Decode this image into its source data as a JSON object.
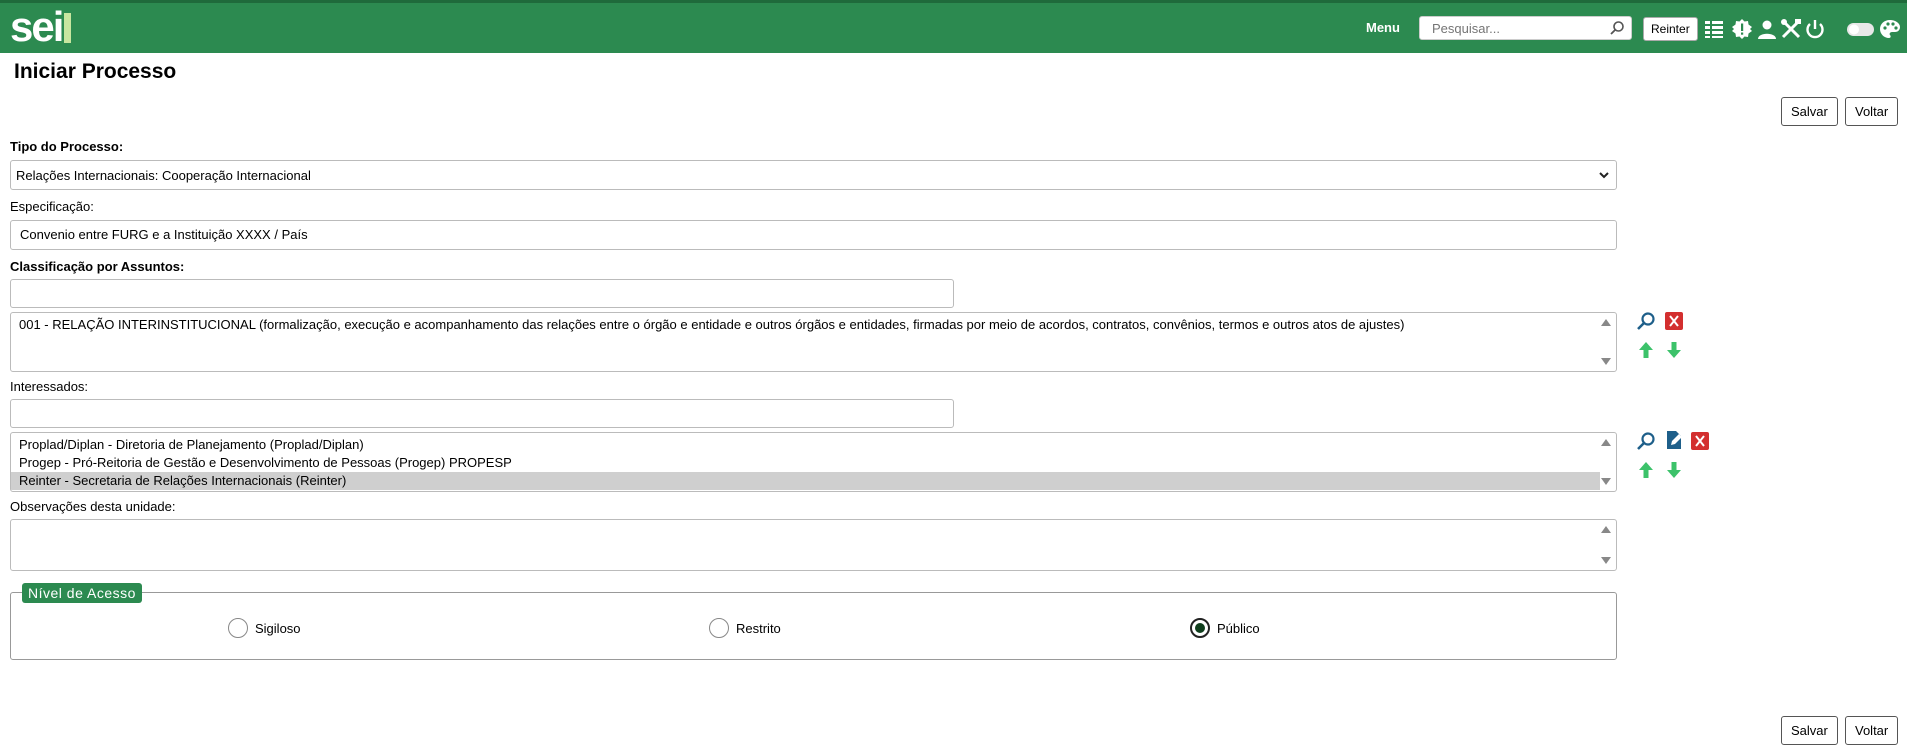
{
  "header": {
    "logo": "sei",
    "menu_label": "Menu",
    "search_placeholder": "Pesquisar...",
    "unit_label": "Reinter"
  },
  "page": {
    "title": "Iniciar Processo",
    "save_label": "Salvar",
    "back_label": "Voltar"
  },
  "form": {
    "tipo_label": "Tipo do Processo:",
    "tipo_value": "Relações Internacionais: Cooperação Internacional",
    "especificacao_label": "Especificação:",
    "especificacao_value": "Convenio entre FURG e a Instituição XXXX / País",
    "classificacao_label": "Classificação por Assuntos:",
    "classificacao_search": "",
    "assuntos": [
      "001 - RELAÇÃO INTERINSTITUCIONAL (formalização, execução e acompanhamento das relações entre o órgão e entidade e outros órgãos e entidades, firmadas por meio de acordos, contratos, convênios, termos e outros atos de ajustes)"
    ],
    "interessados_label": "Interessados:",
    "interessados_search": "",
    "interessados": [
      "Proplad/Diplan - Diretoria de Planejamento (Proplad/Diplan)",
      "Progep - Pró-Reitoria de Gestão e Desenvolvimento de Pessoas (Progep) PROPESP",
      "Reinter - Secretaria de Relações Internacionais (Reinter)"
    ],
    "observacoes_label": "Observações desta unidade:",
    "observacoes_value": ""
  },
  "access": {
    "legend": "Nível de Acesso",
    "options": [
      "Sigiloso",
      "Restrito",
      "Público"
    ],
    "selected": "Público"
  },
  "colors": {
    "header_bg": "#2c8a50",
    "remove_red": "#d32f2f",
    "arrow_green": "#3cc26a",
    "search_blue": "#1e5f8a"
  }
}
